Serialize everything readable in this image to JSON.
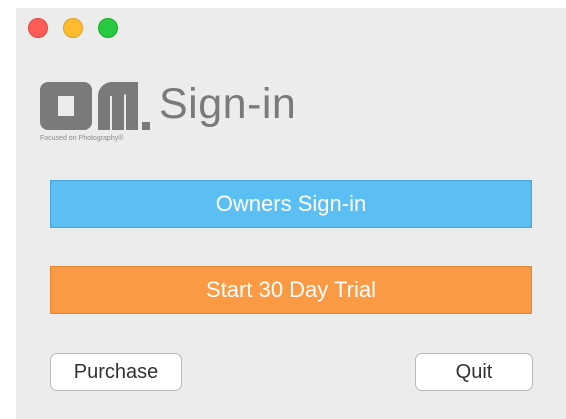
{
  "window": {
    "traffic_lights": {
      "close": "#fd5b58",
      "minimize": "#fdbb2e",
      "zoom": "#27c940"
    }
  },
  "brand": {
    "logo_icon": "on1-logo-icon",
    "tagline": "Focused on Photography®",
    "color": "#7a7a7a"
  },
  "title": "Sign-in",
  "buttons": {
    "owners_signin": "Owners Sign-in",
    "start_trial": "Start 30 Day Trial",
    "purchase": "Purchase",
    "quit": "Quit"
  },
  "colors": {
    "owners_signin_bg": "#5cbff4",
    "start_trial_bg": "#fa9a45"
  }
}
